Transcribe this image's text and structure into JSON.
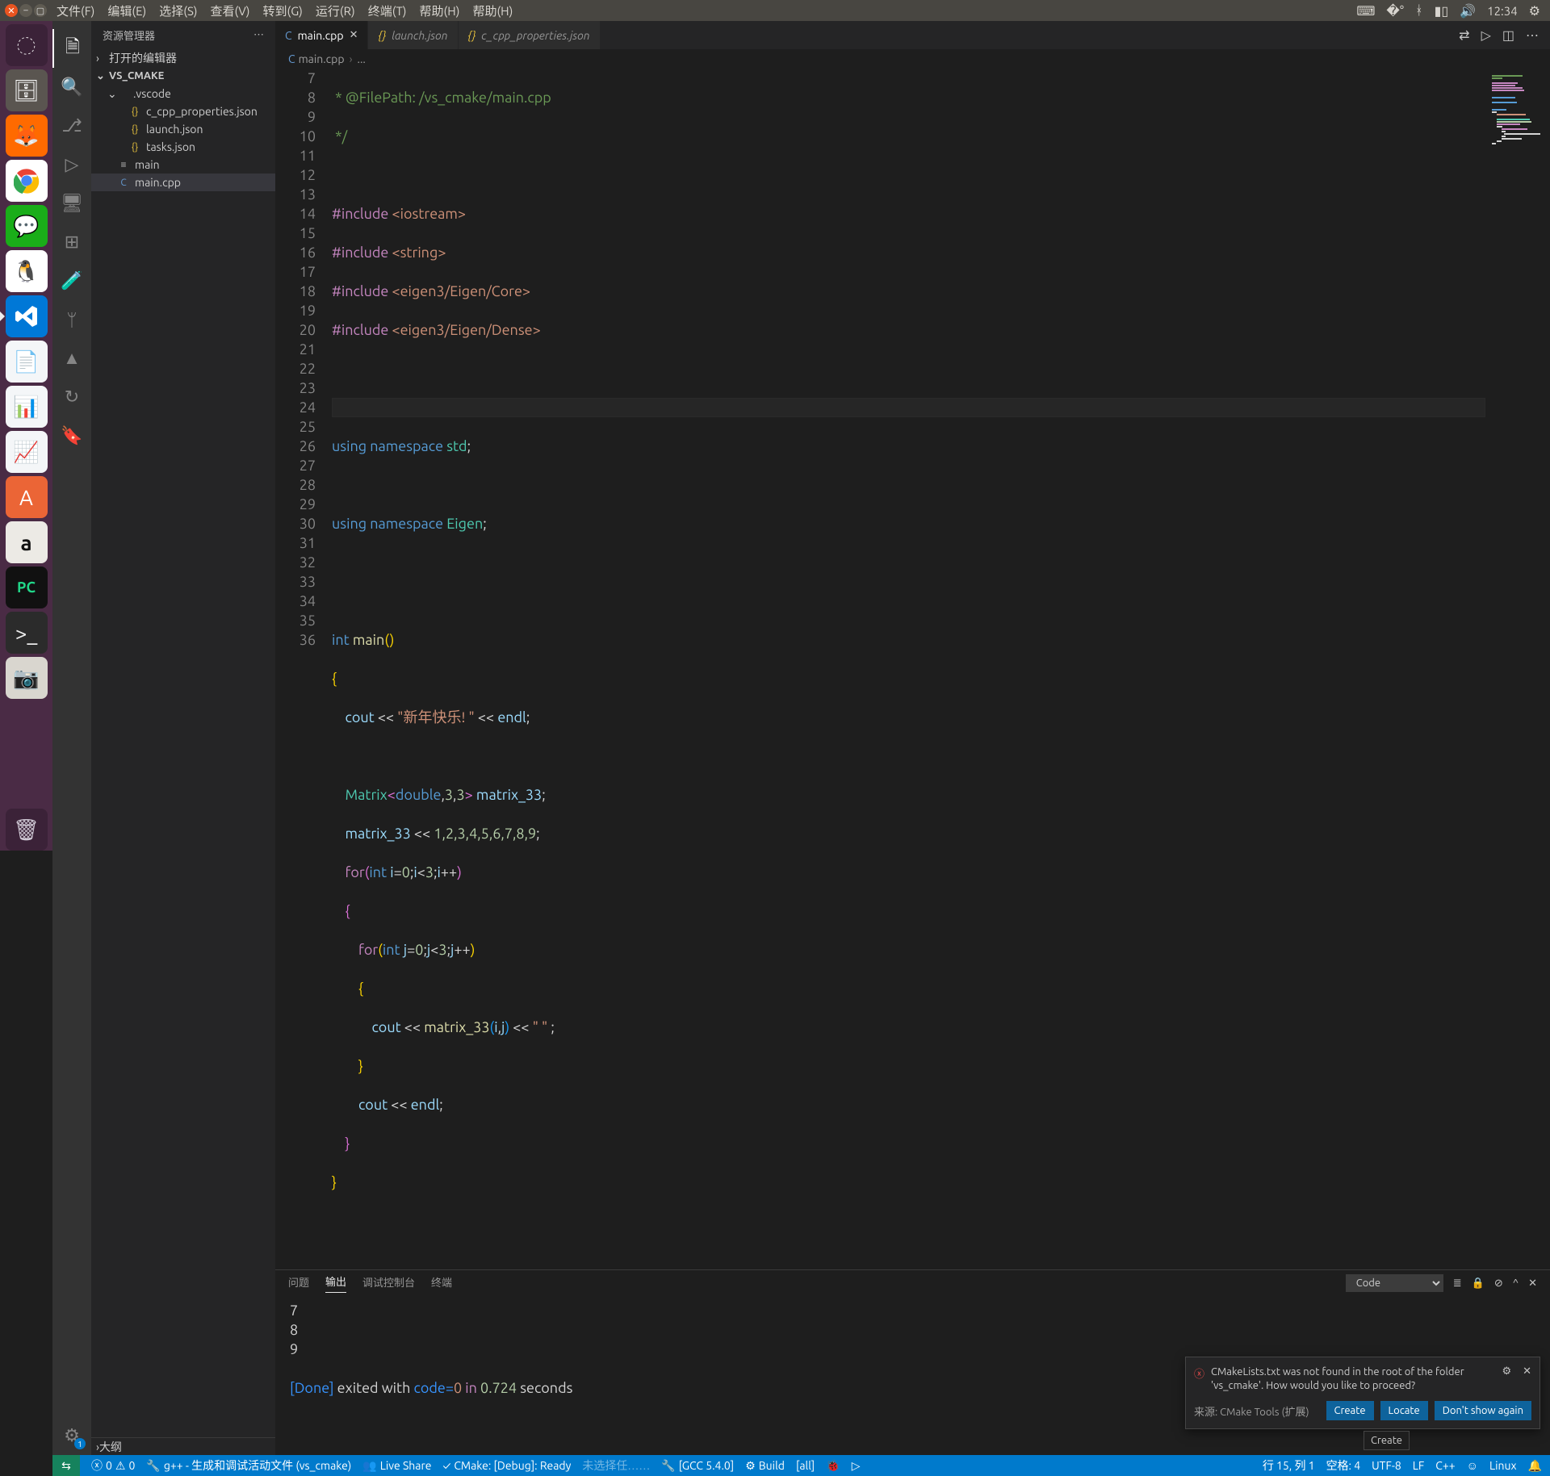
{
  "os": {
    "menu": [
      "文件(F)",
      "编辑(E)",
      "选择(S)",
      "查看(V)",
      "转到(G)",
      "运行(R)",
      "终端(T)",
      "帮助(H)",
      "帮助(H)"
    ],
    "time": "12:34"
  },
  "sidebar": {
    "title": "资源管理器",
    "openEditors": "打开的编辑器",
    "project": "VS_CMAKE",
    "folder": ".vscode",
    "files": {
      "ccpp": "c_cpp_properties.json",
      "launch": "launch.json",
      "tasks": "tasks.json",
      "main_bin": "main",
      "main_cpp": "main.cpp"
    },
    "outline": "大纲"
  },
  "tabs": {
    "main": "main.cpp",
    "launch": "launch.json",
    "ccpp": "c_cpp_properties.json"
  },
  "breadcrumb": {
    "file": "main.cpp",
    "more": "..."
  },
  "code": {
    "l7": " * @FilePath: /vs_cmake/main.cpp",
    "l8": " */",
    "inc": "#include",
    "h1": "<iostream>",
    "h2": "<string>",
    "h3": "<eigen3/Eigen/Core>",
    "h4": "<eigen3/Eigen/Dense>",
    "using": "using",
    "ns": "namespace",
    "std": "std",
    "eigen": "Eigen",
    "int": "int",
    "main": "main",
    "cout": "cout",
    "endl": "endl",
    "happy": "\"新年快乐! \"",
    "Matrix": "Matrix",
    "double": "double",
    "three": "3",
    "m33": "matrix_33",
    "nums": "1,2,3,4,5,6,7,8,9",
    "for": "for",
    "i": "i",
    "j": "j",
    "zero": "0",
    "space": "\" \""
  },
  "panel": {
    "tabs": {
      "problems": "问题",
      "output": "输出",
      "debug": "调试控制台",
      "terminal": "终端"
    },
    "select": "Code",
    "out_l1": "7",
    "out_l2": "8",
    "out_l3": "9",
    "done": "[Done]",
    "exited": " exited with ",
    "codeeq": "code=",
    "zero": "0",
    "in": " in ",
    "secs": "0.724",
    "seconds": " seconds"
  },
  "status": {
    "errors": "0",
    "warnings": "0",
    "gpp": "g++ - 生成和调试活动文件 (vs_cmake)",
    "liveshare": "Live Share",
    "cmake": "CMake: [Debug]: Ready",
    "gcc": "[GCC 5.4.0]",
    "build": "Build",
    "all": "[all]",
    "noselect": "未选择任……",
    "pos": "行 15, 列 1",
    "spaces": "空格: 4",
    "enc": "UTF-8",
    "eol": "LF",
    "lang": "C++",
    "linux": "Linux"
  },
  "notif": {
    "msg": "CMakeLists.txt was not found in the root of the folder 'vs_cmake'. How would you like to proceed?",
    "src": "来源: CMake Tools (扩展)",
    "create": "Create",
    "locate": "Locate",
    "dont": "Don't show again",
    "tip": "Create"
  }
}
